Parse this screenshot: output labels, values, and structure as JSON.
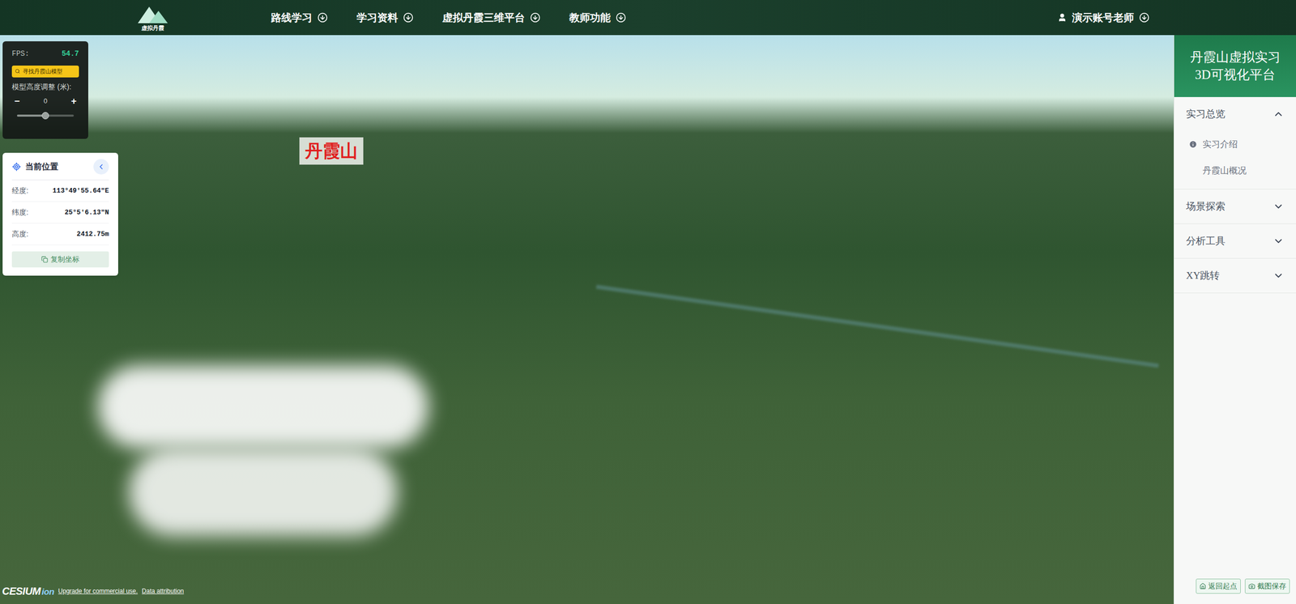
{
  "header": {
    "logo_text": "虚拟丹霞",
    "nav": [
      {
        "label": "路线学习"
      },
      {
        "label": "学习资料"
      },
      {
        "label": "虚拟丹霞三维平台"
      },
      {
        "label": "教师功能"
      }
    ],
    "user": "演示账号老师"
  },
  "sidebar": {
    "title_lines": [
      "丹霞山虚拟实习",
      "3D可视化平台"
    ],
    "sections": [
      {
        "label": "实习总览",
        "expanded": true,
        "items": [
          {
            "label": "实习介绍",
            "kind": "info"
          },
          {
            "label": "丹霞山概况",
            "kind": "plain"
          }
        ]
      },
      {
        "label": "场景探索",
        "expanded": false,
        "items": []
      },
      {
        "label": "分析工具",
        "expanded": false,
        "items": []
      },
      {
        "label": "XY跳转",
        "expanded": false,
        "items": []
      }
    ],
    "footer_buttons": [
      {
        "label": "返回起点",
        "kind": "home"
      },
      {
        "label": "截图保存",
        "kind": "camera"
      }
    ]
  },
  "fps_panel": {
    "fps_label": "FPS:",
    "fps_value": "54.7",
    "find_button": "寻找丹霞山模型",
    "height_label": "模型高度调整 (米):",
    "minus": "−",
    "value": "0",
    "plus": "+",
    "level": 0.5
  },
  "position_panel": {
    "title": "当前位置",
    "rows": [
      {
        "label": "经度:",
        "value": "113°49'55.64\"E"
      },
      {
        "label": "纬度:",
        "value": "25°5'6.13\"N"
      },
      {
        "label": "高度:",
        "value": "2412.75m"
      }
    ],
    "copy_button": "复制坐标"
  },
  "map_labels": [
    {
      "text": "丹霞山"
    }
  ],
  "attribution": {
    "logo": "CESIUM",
    "logo_suffix": "ion",
    "links": [
      "Upgrade for commercial use.",
      "Data attribution"
    ]
  }
}
